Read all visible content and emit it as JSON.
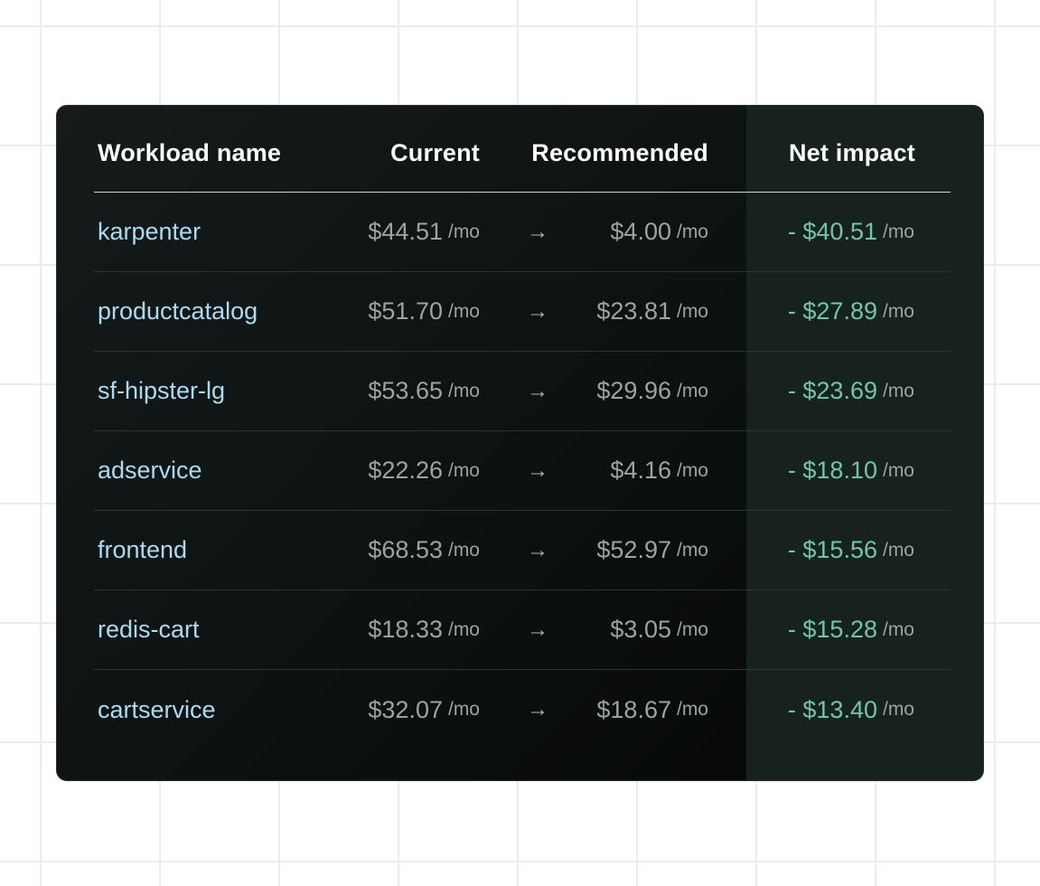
{
  "table": {
    "headers": {
      "workload": "Workload name",
      "current": "Current",
      "recommended": "Recommended",
      "net_impact": "Net impact"
    },
    "arrow_icon": "→",
    "rows": [
      {
        "name": "karpenter",
        "current": "$44.51",
        "current_unit": "/mo",
        "recommended": "$4.00",
        "recommended_unit": "/mo",
        "net": "- $40.51",
        "net_unit": "/mo"
      },
      {
        "name": "productcatalog",
        "current": "$51.70",
        "current_unit": "/mo",
        "recommended": "$23.81",
        "recommended_unit": "/mo",
        "net": "- $27.89",
        "net_unit": "/mo"
      },
      {
        "name": "sf-hipster-lg",
        "current": "$53.65",
        "current_unit": "/mo",
        "recommended": "$29.96",
        "recommended_unit": "/mo",
        "net": "- $23.69",
        "net_unit": "/mo"
      },
      {
        "name": "adservice",
        "current": "$22.26",
        "current_unit": "/mo",
        "recommended": "$4.16",
        "recommended_unit": "/mo",
        "net": "- $18.10",
        "net_unit": "/mo"
      },
      {
        "name": "frontend",
        "current": "$68.53",
        "current_unit": "/mo",
        "recommended": "$52.97",
        "recommended_unit": "/mo",
        "net": "- $15.56",
        "net_unit": "/mo"
      },
      {
        "name": "redis-cart",
        "current": "$18.33",
        "current_unit": "/mo",
        "recommended": "$3.05",
        "recommended_unit": "/mo",
        "net": "- $15.28",
        "net_unit": "/mo"
      },
      {
        "name": "cartservice",
        "current": "$32.07",
        "current_unit": "/mo",
        "recommended": "$18.67",
        "recommended_unit": "/mo",
        "net": "- $13.40",
        "net_unit": "/mo"
      }
    ]
  },
  "colors": {
    "workload_link": "#a9dcf3",
    "savings": "#6ec7a9",
    "muted": "#9da3a2",
    "header_text": "#ffffff",
    "card_bg": "#0e1312",
    "net_column_bg": "#172120"
  }
}
